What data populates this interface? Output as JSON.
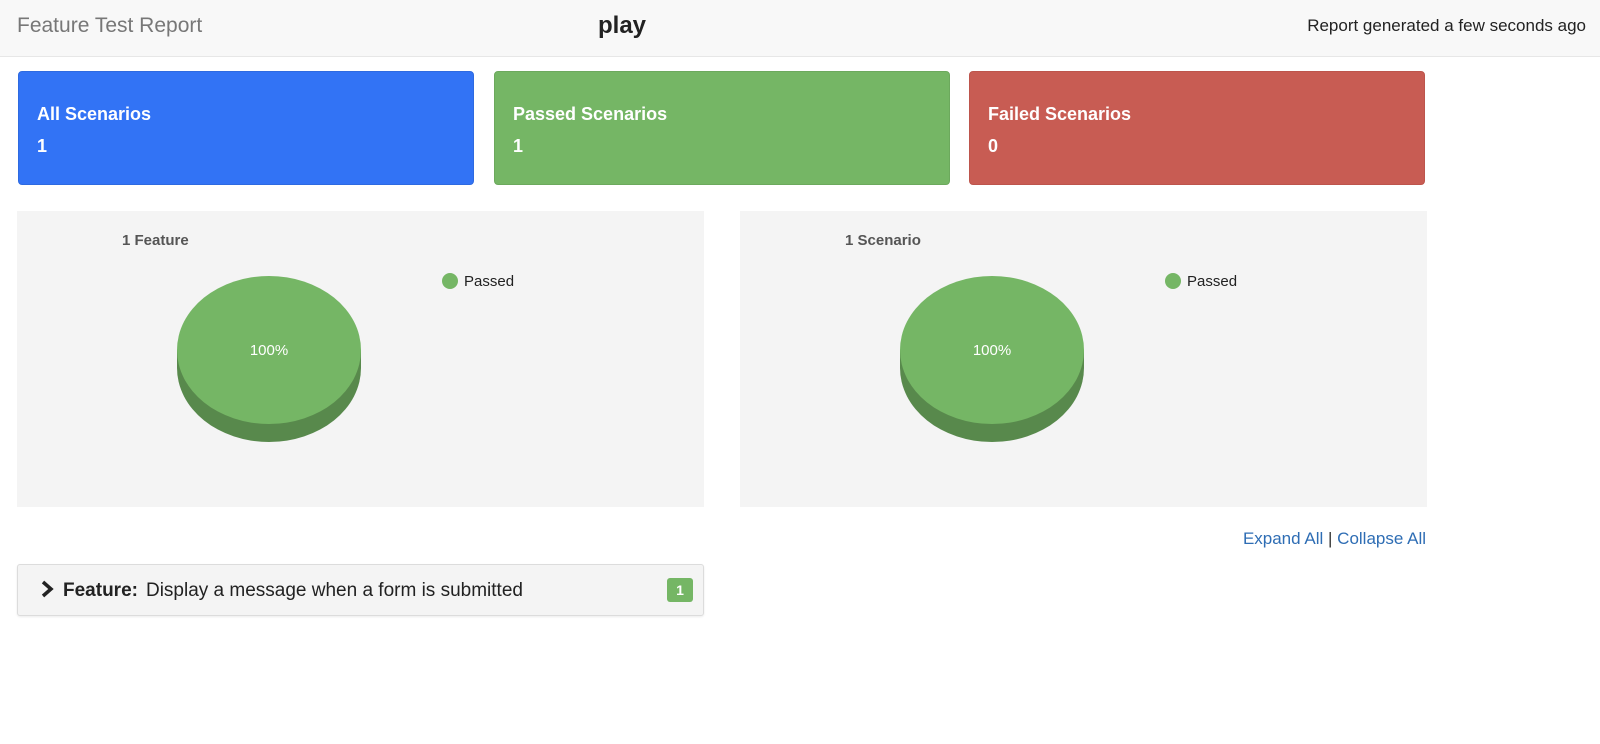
{
  "header": {
    "brand": "Feature Test Report",
    "project": "play",
    "generated": "Report generated a few seconds ago"
  },
  "summary_cards": [
    {
      "label": "All Scenarios",
      "count": "1",
      "color": "#3273f5"
    },
    {
      "label": "Passed Scenarios",
      "count": "1",
      "color": "#75b665"
    },
    {
      "label": "Failed Scenarios",
      "count": "0",
      "color": "#c85c53"
    }
  ],
  "chart_data": [
    {
      "type": "pie",
      "title": "1 Feature",
      "categories": [
        "Passed"
      ],
      "values": [
        100
      ],
      "data_labels": [
        "100%"
      ],
      "colors": [
        "#75b665"
      ],
      "legend": [
        "Passed"
      ],
      "legend_position": "top-right",
      "style": "3d"
    },
    {
      "type": "pie",
      "title": "1 Scenario",
      "categories": [
        "Passed"
      ],
      "values": [
        100
      ],
      "data_labels": [
        "100%"
      ],
      "colors": [
        "#75b665"
      ],
      "legend": [
        "Passed"
      ],
      "legend_position": "top-right",
      "style": "3d"
    }
  ],
  "controls": {
    "expand_all": "Expand All",
    "separator": "|",
    "collapse_all": "Collapse All"
  },
  "features": [
    {
      "keyword": "Feature:",
      "name": "Display a message when a form is submitted",
      "scenario_count": "1",
      "badge_color": "#75b665"
    }
  ]
}
